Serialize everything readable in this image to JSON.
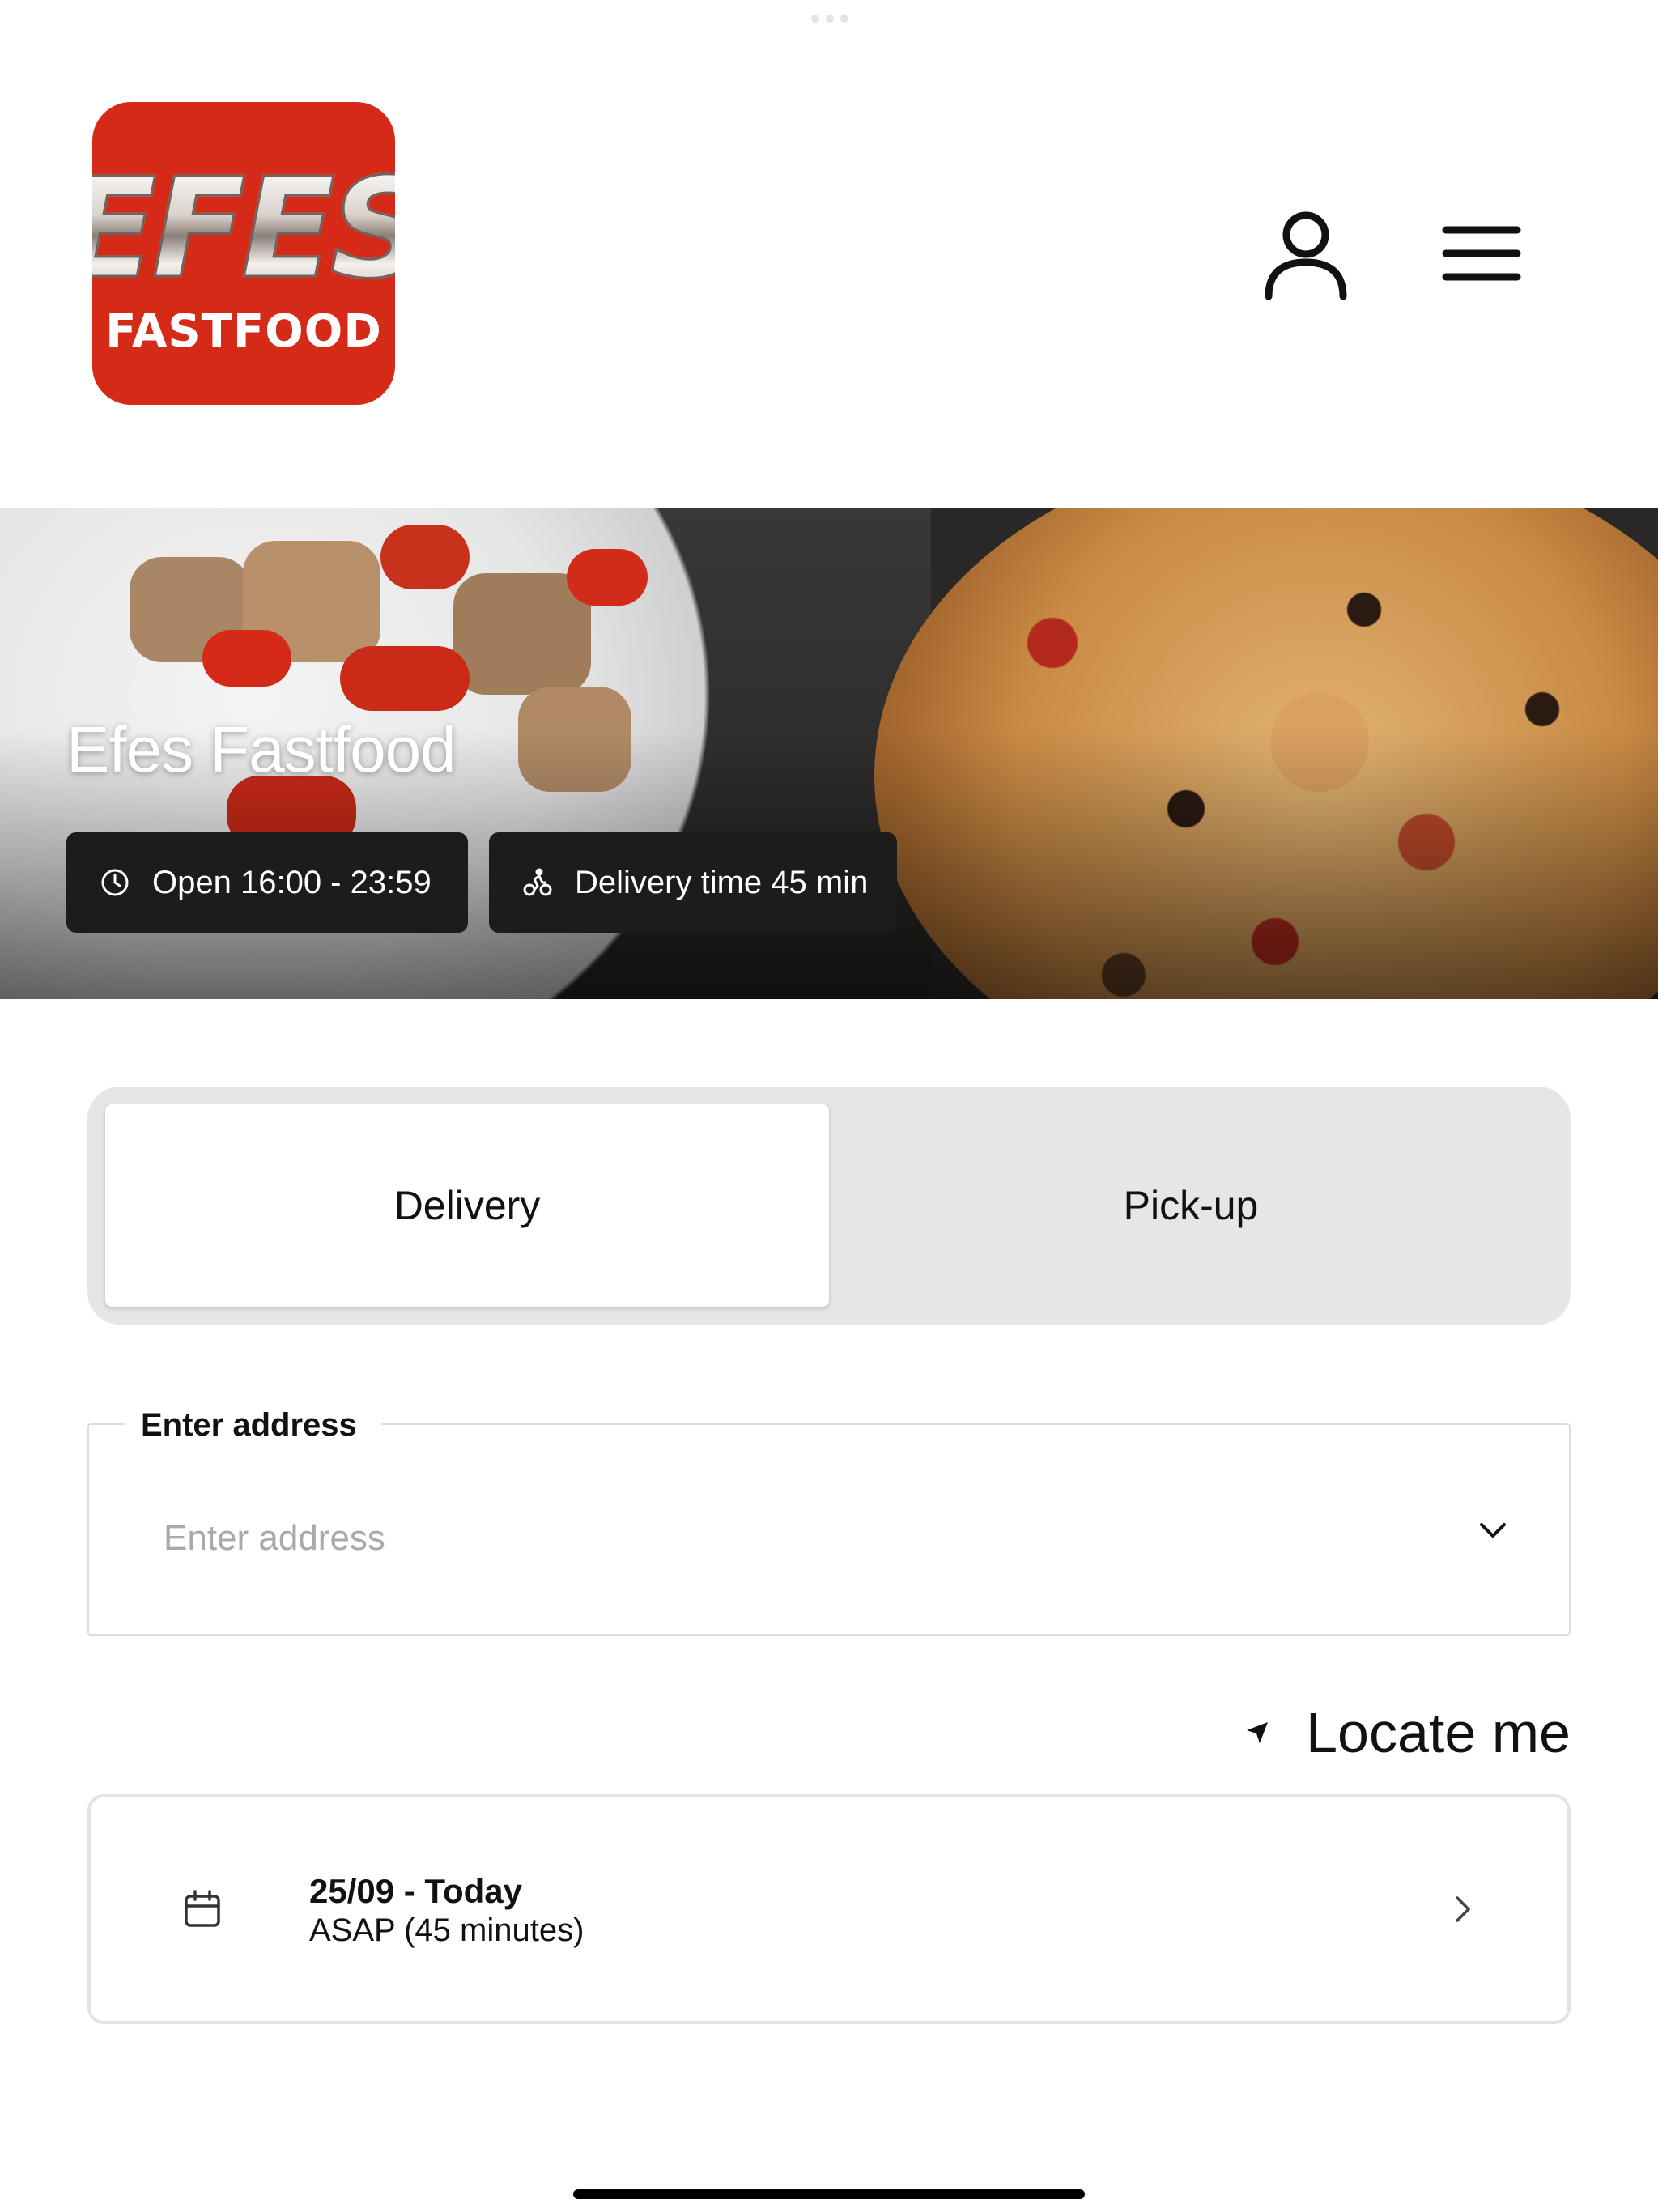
{
  "header": {
    "logo": {
      "wordmark": "EFES",
      "subtitle": "FASTFOOD",
      "background_color": "#d42a17"
    },
    "account_icon": "user-icon",
    "menu_icon": "hamburger-menu-icon"
  },
  "hero": {
    "restaurant_name": "Efes Fastfood",
    "opening_hours": "Open 16:00 - 23:59",
    "opening_hours_icon": "clock-icon",
    "delivery_time": "Delivery time 45 min",
    "delivery_time_icon": "bicycle-courier-icon"
  },
  "order_type": {
    "options": [
      "Delivery",
      "Pick-up"
    ],
    "selected": "Delivery"
  },
  "address": {
    "label": "Enter address",
    "placeholder": "Enter address",
    "value": ""
  },
  "locate": {
    "label": "Locate me",
    "icon": "location-arrow-icon"
  },
  "schedule": {
    "date": "25/09 - Today",
    "time": "ASAP (45 minutes)",
    "icon": "calendar-icon"
  },
  "colors": {
    "brand": "#d42a17",
    "chip_background": "#1c1c1c",
    "segment_background": "#e6e6e6"
  }
}
